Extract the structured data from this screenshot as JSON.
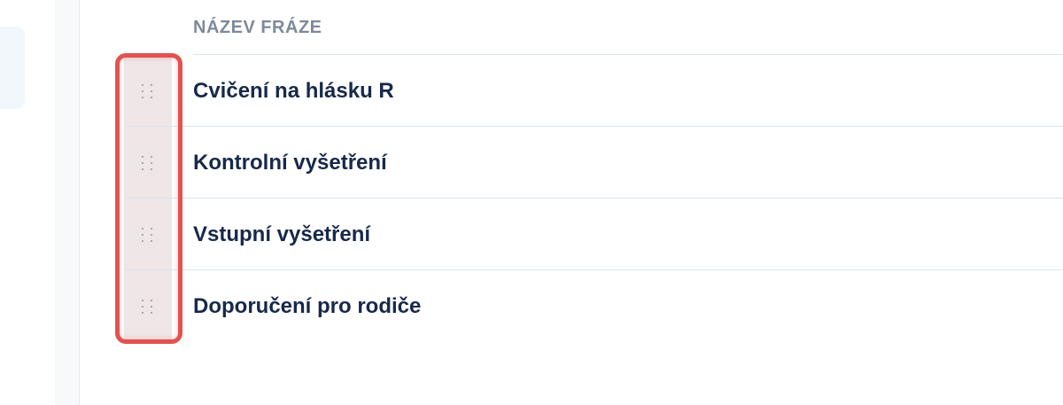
{
  "table": {
    "column_header": "NÁZEV FRÁZE",
    "rows": [
      {
        "label": "Cvičení na hlásku R",
        "handle_icon": "drag-handle-icon"
      },
      {
        "label": "Kontrolní vyšetření",
        "handle_icon": "drag-handle-icon"
      },
      {
        "label": "Vstupní vyšetření",
        "handle_icon": "drag-handle-icon"
      },
      {
        "label": "Doporučení pro rodiče",
        "handle_icon": "drag-handle-icon"
      }
    ]
  },
  "colors": {
    "text_primary": "#17294a",
    "header_text": "#7d8a99",
    "highlight": "#e25350",
    "row_divider": "#d9e5ee"
  }
}
